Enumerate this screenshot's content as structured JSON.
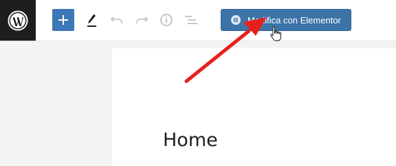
{
  "toolbar": {
    "elementor_button_label": "Modifica con Elementor"
  },
  "content": {
    "page_title": "Home"
  },
  "colors": {
    "logo_bg": "#1e1e1e",
    "accent_blue": "#3b78b5",
    "elementor_button_bg": "#3d74a8",
    "annotation_arrow": "#e8201c"
  },
  "icons": {
    "logo": "wordpress-logo-icon",
    "add": "plus-icon",
    "tools": "pencil-icon",
    "undo": "undo-icon",
    "redo": "redo-icon",
    "info": "info-icon",
    "outline": "list-view-icon",
    "elementor": "elementor-icon",
    "cursor": "hand-cursor-icon"
  }
}
